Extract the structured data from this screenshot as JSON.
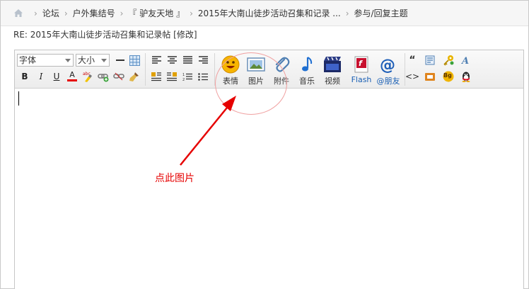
{
  "breadcrumb": {
    "items": [
      "论坛",
      "户外集结号",
      "『 驴友天地 』",
      "2015年大南山徒步活动召集和记录 ...",
      "参与/回复主题"
    ],
    "separator": "›"
  },
  "subject": {
    "text": "RE: 2015年大南山徒步活动召集和记录帖",
    "edit_open": "[",
    "edit_label": "修改",
    "edit_close": "]"
  },
  "toolbar": {
    "font_select": "字体",
    "size_select": "大小",
    "bold": "B",
    "italic": "I",
    "underline": "U",
    "font_color": "A",
    "big_buttons": [
      {
        "label": "表情",
        "icon": "smiley-icon"
      },
      {
        "label": "图片",
        "icon": "image-icon"
      },
      {
        "label": "附件",
        "icon": "paperclip-icon"
      },
      {
        "label": "音乐",
        "icon": "music-note-icon"
      },
      {
        "label": "视频",
        "icon": "video-icon"
      },
      {
        "label": "Flash",
        "icon": "flash-icon"
      },
      {
        "label": "@朋友",
        "icon": "at-icon"
      }
    ],
    "quote": "“",
    "code": "<>",
    "bg": "Bg",
    "colors": {
      "flash_label": "#1a5fb4",
      "at_label": "#1a5fb4",
      "accent": "#e60000"
    }
  },
  "annotation": {
    "text": "点此图片"
  }
}
